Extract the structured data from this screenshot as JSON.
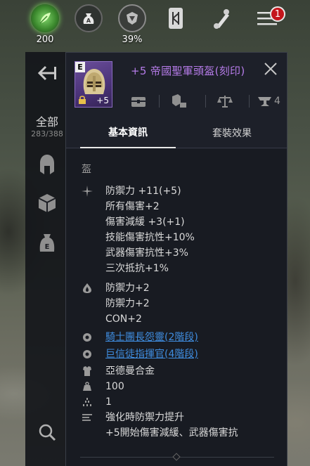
{
  "hud": {
    "items": [
      {
        "icon": "green-leaf-icon",
        "value": "200"
      },
      {
        "icon": "money-bag-icon",
        "value": ""
      },
      {
        "icon": "shield-emblem-icon",
        "value": "39%"
      },
      {
        "icon": "rune-tablet-icon",
        "value": ""
      },
      {
        "icon": "scroll-icon",
        "value": ""
      },
      {
        "icon": "menu-icon",
        "value": "",
        "badge": "1"
      }
    ]
  },
  "sidebar": {
    "category_title": "全部",
    "category_count": "283/388",
    "icons": [
      "back-arrow-icon",
      "helmet-icon",
      "cube-icon",
      "e-bag-icon",
      "search-icon"
    ]
  },
  "item": {
    "grade_badge": "E",
    "enhance_badge": "+5",
    "title": "+5 帝國聖軍頭盔(刻印)",
    "title_color": "#b57be8",
    "header_icons": [
      "chest-icon",
      "decompose-icon",
      "scale-icon",
      "anvil-icon"
    ],
    "anvil_count": "4"
  },
  "tabs": [
    {
      "label": "基本資訊",
      "active": true
    },
    {
      "label": "套裝效果",
      "active": false
    }
  ],
  "details": {
    "category": "盔",
    "rows": [
      {
        "icon": "sparkle-icon",
        "text": "防禦力 +11(+5)"
      },
      {
        "icon": "",
        "text": "所有傷害+2"
      },
      {
        "icon": "",
        "text": "傷害減緩 +3(+1)"
      },
      {
        "icon": "",
        "text": "技能傷害抗性+10%"
      },
      {
        "icon": "",
        "text": "武器傷害抗性+3%"
      },
      {
        "icon": "",
        "text": "三次抵抗+1%"
      },
      {
        "icon": "shield-drop-icon",
        "text": "防禦力+2"
      },
      {
        "icon": "",
        "text": "防禦力+2"
      },
      {
        "icon": "",
        "text": "CON+2"
      },
      {
        "icon": "set-orb-icon",
        "text": "騎士團長怨靈(2階段)",
        "link": true
      },
      {
        "icon": "set-orb-icon",
        "text": "巨信徒指揮官(4階段)",
        "link": true
      },
      {
        "icon": "armor-icon",
        "text": "亞德曼合金"
      },
      {
        "icon": "weight-icon",
        "text": "100"
      },
      {
        "icon": "tier-icon",
        "text": "1"
      },
      {
        "icon": "list-icon",
        "text": "強化時防禦力提升"
      },
      {
        "icon": "",
        "text": "+5開始傷害減緩、武器傷害抗"
      }
    ]
  }
}
